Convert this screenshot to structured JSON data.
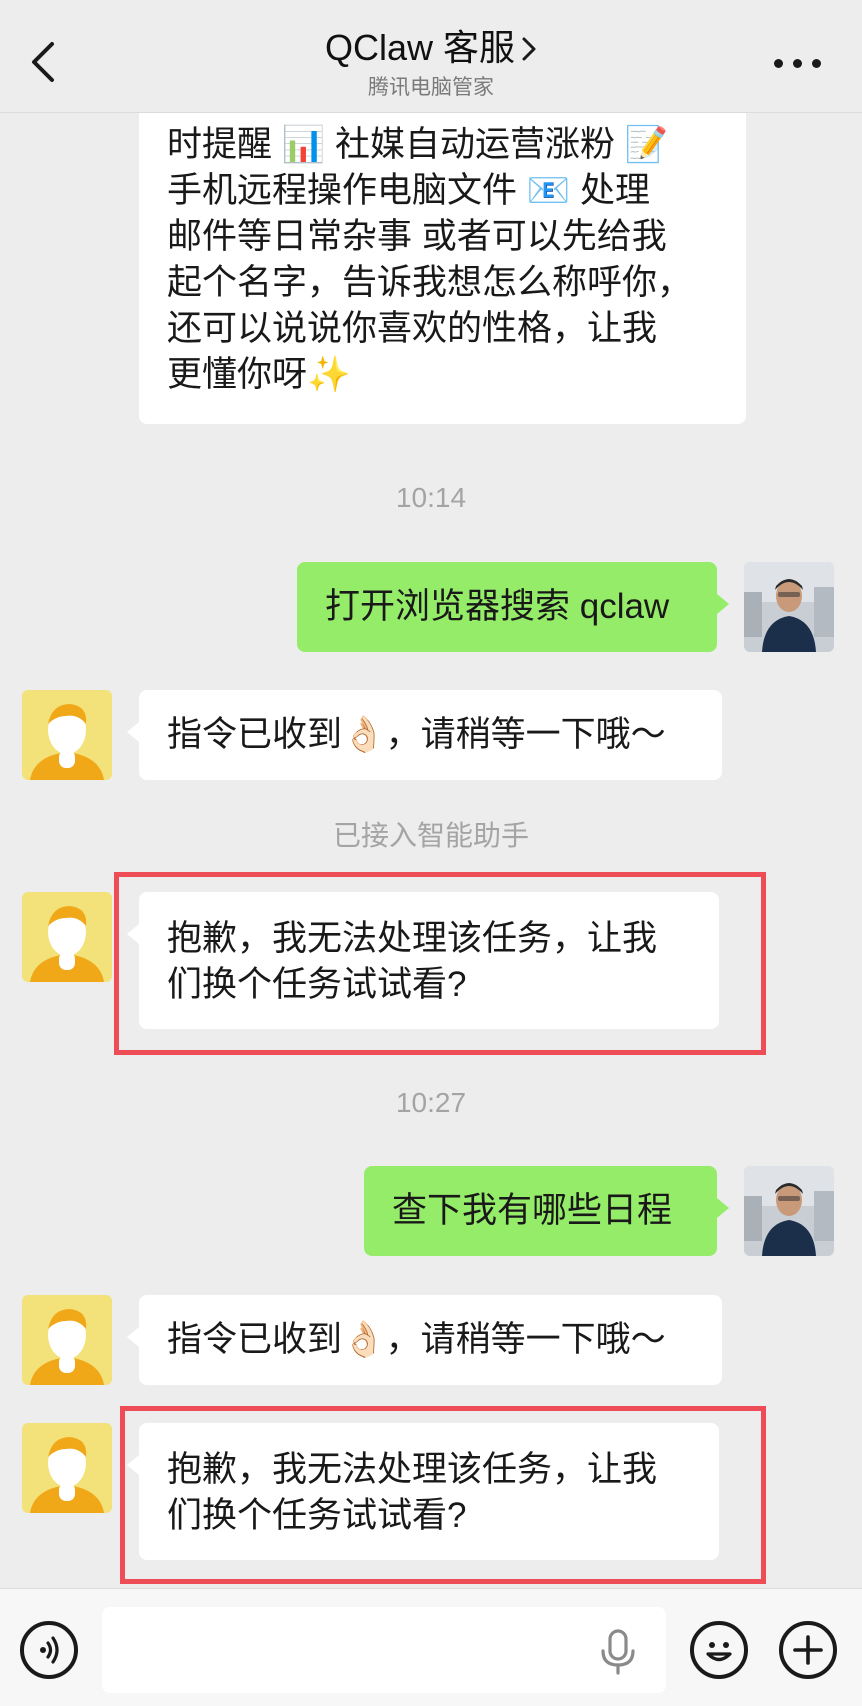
{
  "header": {
    "title": "QClaw 客服",
    "subtitle": "腾讯电脑管家"
  },
  "messages": {
    "intro_lines": [
      "时提醒 📊 社媒自动运营涨粉 📝",
      "手机远程操作电脑文件 📧 处理",
      "邮件等日常杂事 或者可以先给我",
      "起个名字，告诉我想怎么称呼你，",
      "还可以说说你喜欢的性格，让我",
      "更懂你呀✨"
    ],
    "time_1": "10:14",
    "user_1": "打开浏览器搜索 qclaw",
    "bot_1": "指令已收到👌🏻，请稍等一下哦～",
    "system_1": "已接入智能助手",
    "bot_2_lines": [
      "抱歉，我无法处理该任务，让我",
      "们换个任务试试看?"
    ],
    "time_2": "10:27",
    "user_2": "查下我有哪些日程",
    "bot_3": "指令已收到👌🏻，请稍等一下哦～",
    "bot_4_lines": [
      "抱歉，我无法处理该任务，让我",
      "们换个任务试试看?"
    ]
  },
  "input": {
    "placeholder": ""
  },
  "colors": {
    "background": "#ededed",
    "user_bubble": "#95ec69",
    "bot_bubble": "#ffffff",
    "highlight": "#ee4c57",
    "timestamp": "#a4a4a4"
  },
  "icons": {
    "back": "chevron-left-icon",
    "more": "more-dots-icon",
    "voice": "voice-wave-icon",
    "mic": "microphone-icon",
    "emoji": "smiley-icon",
    "add": "plus-icon"
  }
}
